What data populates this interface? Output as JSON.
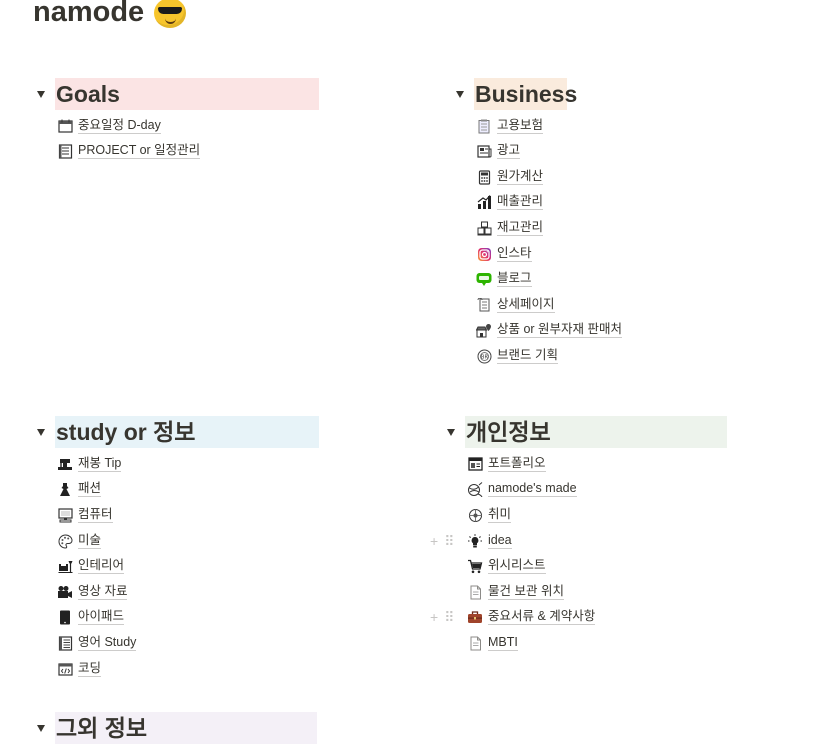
{
  "page": {
    "title": "namode",
    "title_emoji": "sunglasses-emoji"
  },
  "sections": {
    "goals": {
      "title": "Goals",
      "bg": "#fbe4e4",
      "items": [
        {
          "label": "중요일정 D-day",
          "icon": "calendar-icon"
        },
        {
          "label": "PROJECT or 일정관리",
          "icon": "ledger-icon"
        }
      ]
    },
    "business": {
      "title": "Business",
      "bg": "#faebdd",
      "items": [
        {
          "label": "고용보험",
          "icon": "notepad-icon"
        },
        {
          "label": "광고",
          "icon": "newspaper-icon"
        },
        {
          "label": "원가계산",
          "icon": "calculator-icon"
        },
        {
          "label": "매출관리",
          "icon": "bar-chart-icon"
        },
        {
          "label": "재고관리",
          "icon": "boxes-icon"
        },
        {
          "label": "인스타",
          "icon": "instagram-icon"
        },
        {
          "label": "블로그",
          "icon": "blog-icon"
        },
        {
          "label": "상세페이지",
          "icon": "scroll-icon"
        },
        {
          "label": "상품 or 원부자재 판매처",
          "icon": "store-pin-icon"
        },
        {
          "label": "브랜드 기획",
          "icon": "brand-icon"
        }
      ]
    },
    "study": {
      "title": "study or 정보",
      "bg": "#e7f3f8",
      "items": [
        {
          "label": "재봉 Tip",
          "icon": "sewing-machine-icon"
        },
        {
          "label": "패션",
          "icon": "dress-icon"
        },
        {
          "label": "컴퓨터",
          "icon": "computer-icon"
        },
        {
          "label": "미술",
          "icon": "palette-icon"
        },
        {
          "label": "인테리어",
          "icon": "interior-icon"
        },
        {
          "label": "영상 자료",
          "icon": "video-camera-icon"
        },
        {
          "label": "아이패드",
          "icon": "tablet-icon"
        },
        {
          "label": "영어 Study",
          "icon": "book-icon"
        },
        {
          "label": "코딩",
          "icon": "code-icon"
        }
      ]
    },
    "personal": {
      "title": "개인정보",
      "bg": "#edf3ec",
      "items": [
        {
          "label": "포트폴리오",
          "icon": "portfolio-icon"
        },
        {
          "label": "namode's made",
          "icon": "yarn-icon"
        },
        {
          "label": "취미",
          "icon": "hobby-icon"
        },
        {
          "label": "idea",
          "icon": "lightbulb-icon"
        },
        {
          "label": "위시리스트",
          "icon": "cart-icon"
        },
        {
          "label": "물건 보관 위치",
          "icon": "page-icon"
        },
        {
          "label": "중요서류 & 계약사항",
          "icon": "briefcase-icon"
        },
        {
          "label": "MBTI",
          "icon": "page-icon"
        }
      ]
    },
    "other": {
      "title": "그외 정보",
      "bg": "#f4f0f7"
    }
  },
  "colors": {
    "text": "#37352f",
    "underline": "#c9c8c5",
    "handle": "#c7c6c4"
  }
}
